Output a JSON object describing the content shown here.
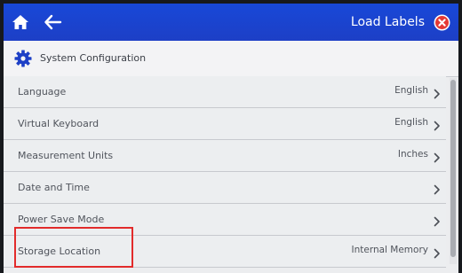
{
  "topbar": {
    "title": "Load Labels",
    "home_icon": "home-icon",
    "back_icon": "back-arrow-icon",
    "close_icon": "close-icon"
  },
  "section": {
    "title": "System Configuration",
    "icon": "gear-icon"
  },
  "settings": [
    {
      "label": "Language",
      "value": "English"
    },
    {
      "label": "Virtual Keyboard",
      "value": "English"
    },
    {
      "label": "Measurement Units",
      "value": "Inches"
    },
    {
      "label": "Date and Time",
      "value": ""
    },
    {
      "label": "Power Save Mode",
      "value": ""
    },
    {
      "label": "Storage Location",
      "value": "Internal Memory"
    }
  ],
  "colors": {
    "topbar": "#1d3fc6",
    "screen_background": "#ecedef",
    "highlight": "#e22b2b",
    "close_button": "#e53935"
  }
}
